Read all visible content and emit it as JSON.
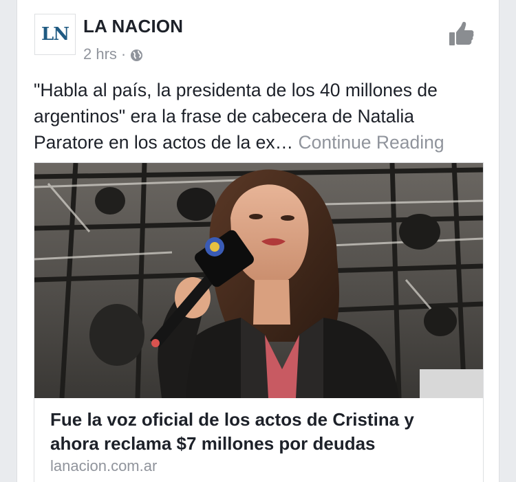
{
  "post": {
    "page_name": "LA NACION",
    "avatar_text": "LN",
    "time": "2 hrs",
    "separator": "·",
    "privacy_icon": "globe-icon",
    "like_icon": "thumbs-up-icon",
    "text": "\"Habla al país, la presidenta de los 40 millones de argentinos\" era la frase de cabecera de Natalia Paratore en los actos de la ex… ",
    "continue_label": "Continue Reading"
  },
  "link": {
    "headline": "Fue la voz oficial de los actos de Cristina y ahora reclama $7 millones por deudas",
    "domain": "lanacion.com.ar"
  },
  "colors": {
    "text_primary": "#1d2129",
    "text_secondary": "#90949c",
    "brand_blue": "#1f5a82",
    "border": "#dddfe2"
  }
}
